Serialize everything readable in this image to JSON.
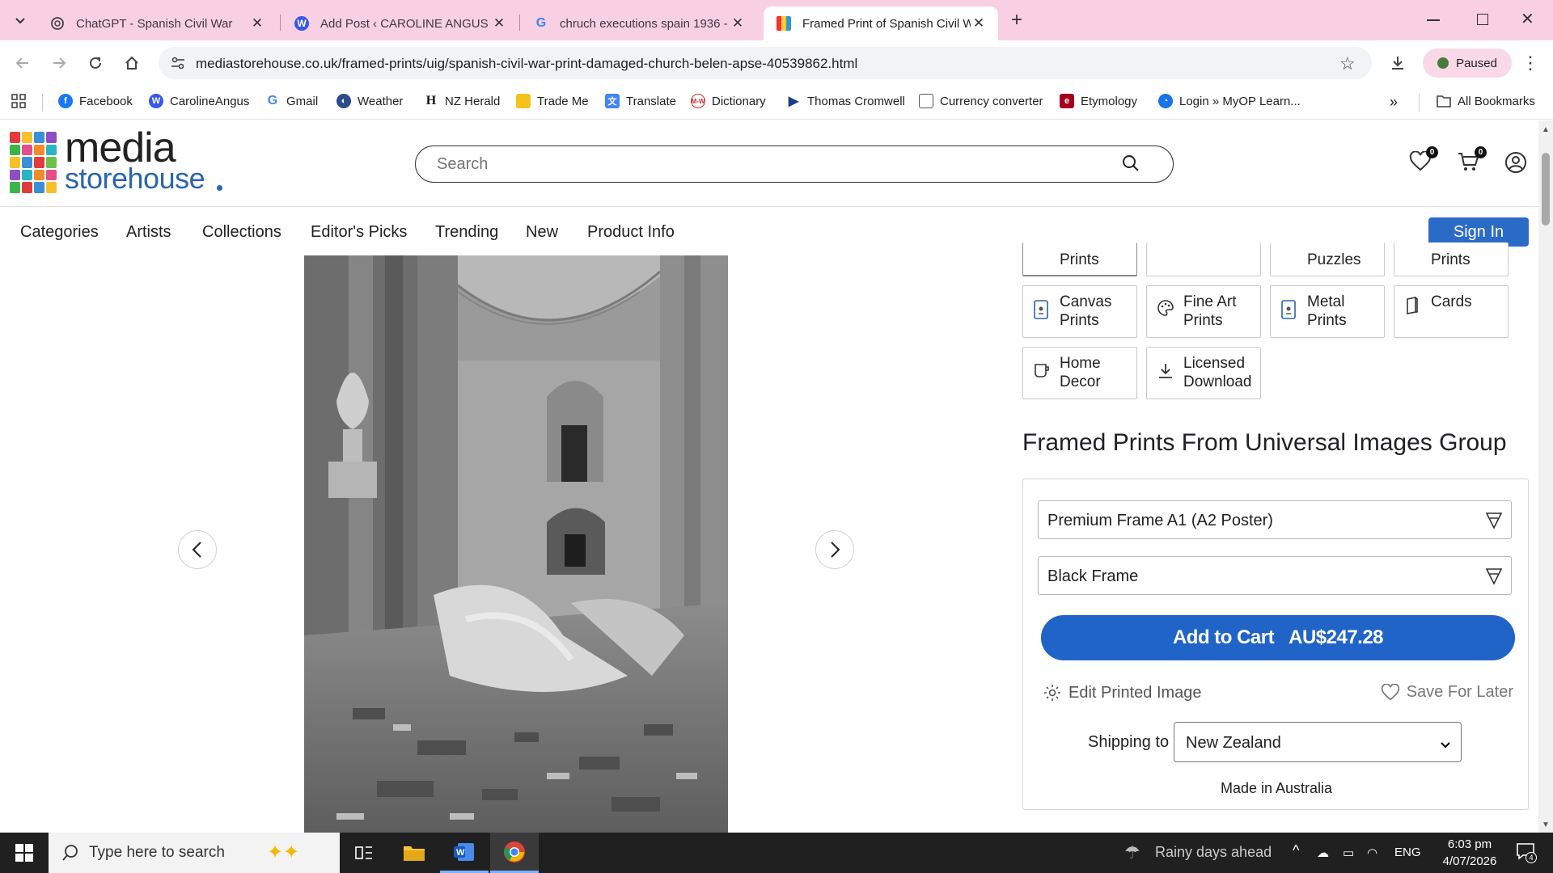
{
  "browser": {
    "tabs": [
      {
        "title": "ChatGPT - Spanish Civil War",
        "icon": "chatgpt-icon"
      },
      {
        "title": "Add Post ‹ CAROLINE ANGUS —",
        "icon": "wordpress-icon"
      },
      {
        "title": "chruch executions spain 1936 -",
        "icon": "google-icon"
      },
      {
        "title": "Framed Print of Spanish Civil W",
        "icon": "mediastorehouse-icon",
        "active": true
      }
    ],
    "url": "mediastorehouse.co.uk/framed-prints/uig/spanish-civil-war-print-damaged-church-belen-apse-40539862.html",
    "profile_status": "Paused",
    "bookmarks": [
      "Facebook",
      "CarolineAngus",
      "Gmail",
      "Weather",
      "NZ Herald",
      "Trade Me",
      "Translate",
      "Dictionary",
      "Thomas Cromwell",
      "Currency converter",
      "Etymology",
      "Login » MyOP Learn..."
    ],
    "all_bookmarks": "All Bookmarks",
    "overflow": "»"
  },
  "site": {
    "logo_line1": "media",
    "logo_line2": "storehouse",
    "search_placeholder": "Search",
    "wishlist_count": "0",
    "cart_count": "0",
    "nav": [
      "Categories",
      "Artists",
      "Collections",
      "Editor's Picks",
      "Trending",
      "New",
      "Product Info"
    ],
    "sign_in": "Sign In"
  },
  "product_types": {
    "partial_row": [
      "Prints",
      "",
      "Puzzles",
      "Prints"
    ],
    "row2": [
      "Canvas Prints",
      "Fine Art Prints",
      "Metal Prints",
      "Cards"
    ],
    "row3": [
      "Home Decor",
      "Licensed Download"
    ]
  },
  "product": {
    "title": "Framed Prints From Universal Images Group",
    "size_option": "Premium Frame A1 (A2 Poster)",
    "frame_option": "Black Frame",
    "add_to_cart": "Add to Cart",
    "price": "AU$247.28",
    "edit_image": "Edit Printed Image",
    "save_later": "Save For Later",
    "shipping_label": "Shipping to",
    "shipping_country": "New Zealand",
    "made_in": "Made in Australia"
  },
  "taskbar": {
    "search_placeholder": "Type here to search",
    "weather": "Rainy days ahead",
    "language": "ENG",
    "time": "6:03 pm",
    "date": "4/07/2026",
    "notifications": "4"
  },
  "colors": {
    "tabstrip": "#f9cfe3",
    "brand_blue": "#2b64b0",
    "cart_button": "#2064c8"
  }
}
